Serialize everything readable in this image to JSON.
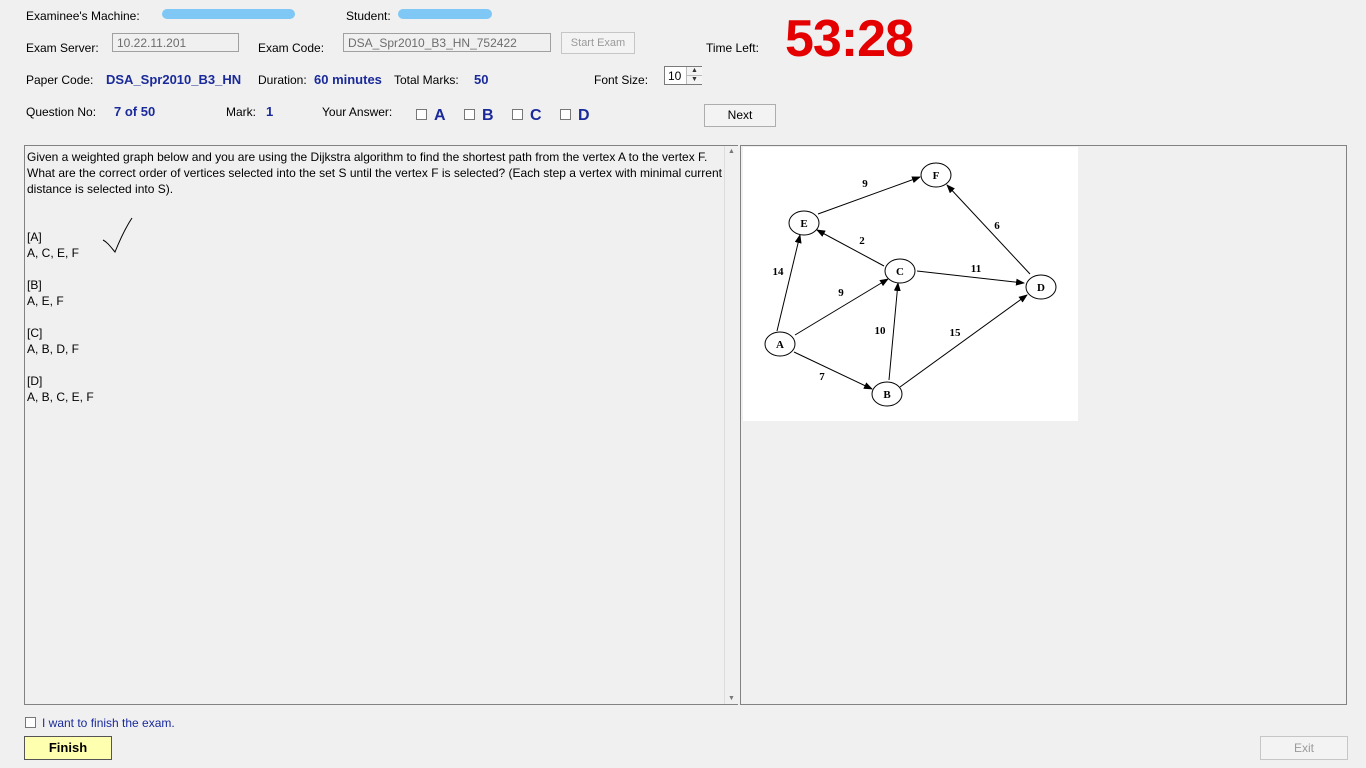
{
  "header": {
    "examinee_machine_label": "Examinee's Machine:",
    "student_label": "Student:",
    "exam_server_label": "Exam Server:",
    "exam_server_value": "10.22.11.201",
    "exam_code_label": "Exam Code:",
    "exam_code_value": "DSA_Spr2010_B3_HN_752422",
    "start_exam_label": "Start Exam",
    "time_left_label": "Time Left:",
    "time_left_value": "53:28",
    "paper_code_label": "Paper Code:",
    "paper_code_value": "DSA_Spr2010_B3_HN",
    "duration_label": "Duration:",
    "duration_value": "60 minutes",
    "total_marks_label": "Total Marks:",
    "total_marks_value": "50",
    "font_size_label": "Font Size:",
    "font_size_value": "10",
    "question_no_label": "Question No:",
    "question_no_value": "7 of 50",
    "mark_label": "Mark:",
    "mark_value": "1",
    "your_answer_label": "Your Answer:",
    "options": [
      "A",
      "B",
      "C",
      "D"
    ],
    "next_label": "Next"
  },
  "question": {
    "text": "Given a weighted graph below and you are using the Dijkstra algorithm to find the shortest path from the vertex  A  to the vertex  F. What are the correct order of vertices selected into the set  S until the vertex  F  is selected? (Each step a vertex with minimal current distance is selected into S).",
    "answers": [
      {
        "tag": "[A]",
        "text": "A, C, E, F"
      },
      {
        "tag": "[B]",
        "text": "A,  E, F"
      },
      {
        "tag": "[C]",
        "text": "A, B, D, F"
      },
      {
        "tag": "[D]",
        "text": "A, B, C, E, F"
      }
    ]
  },
  "graph": {
    "nodes": [
      "A",
      "B",
      "C",
      "D",
      "E",
      "F"
    ],
    "weights": {
      "AE": "14",
      "AC": "9",
      "AB": "7",
      "BC": "10",
      "BD": "15",
      "CE": "2",
      "CD": "11",
      "EF": "9",
      "DF": "6"
    }
  },
  "footer": {
    "finish_checkbox_label": "I want to finish the exam.",
    "finish_label": "Finish",
    "exit_label": "Exit"
  },
  "colors": {
    "timer": "#e40000",
    "value_text": "#1a2a9a",
    "finish_button": "#ffffb0"
  }
}
